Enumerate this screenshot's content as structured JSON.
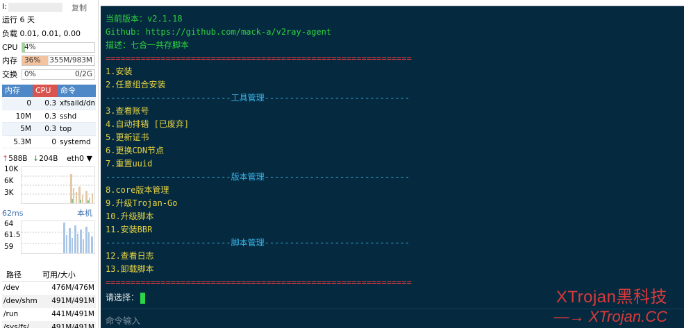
{
  "colors": {
    "terminal_bg": "#052a40",
    "green": "#2fd33b",
    "red": "#ff3b3b",
    "yellow": "#e6d23f",
    "blue": "#39b3e6",
    "watermark": "#d93a3a"
  },
  "monitor": {
    "ip_label": "I:",
    "copy_label": "复制",
    "uptime": "运行 6 天",
    "load": "负载 0.01, 0.01, 0.00",
    "cpu": {
      "label": "CPU",
      "value": "4%",
      "percent": 4
    },
    "memory": {
      "label": "内存",
      "value": "36%",
      "detail": "355M/983M",
      "percent": 36
    },
    "swap": {
      "label": "交换",
      "value": "0%",
      "detail": "0/2G",
      "percent": 0
    },
    "process_headers": [
      "内存",
      "CPU",
      "命令"
    ],
    "processes": [
      {
        "mem": "0",
        "cpu": "0.3",
        "cmd": "xfsaild/dn"
      },
      {
        "mem": "10M",
        "cpu": "0.3",
        "cmd": "sshd"
      },
      {
        "mem": "5M",
        "cpu": "0.3",
        "cmd": "top"
      },
      {
        "mem": "5.3M",
        "cpu": "0",
        "cmd": "systemd"
      }
    ],
    "net": {
      "up": "588B",
      "down": "204B",
      "iface": "eth0",
      "ticks": [
        "10K",
        "6K",
        "3K"
      ]
    },
    "ping": {
      "latency": "62ms",
      "host": "本机",
      "ticks": [
        "64",
        "61.5",
        "59"
      ]
    },
    "disk_headers": [
      "路径",
      "可用/大小"
    ],
    "disks": [
      {
        "path": "/dev",
        "size": "476M/476M"
      },
      {
        "path": "/dev/shm",
        "size": "491M/491M"
      },
      {
        "path": "/run",
        "size": "441M/491M"
      },
      {
        "path": "/sys/fs/",
        "size": "491M/491M"
      }
    ]
  },
  "terminal": {
    "version": "当前版本：v2.1.18",
    "github": "Github: https://github.com/mack-a/v2ray-agent",
    "desc": "描述：七合一共存脚本",
    "separator": "=============================================================",
    "items1": [
      "1.安装",
      "2.任意组合安装"
    ],
    "section_tools": "-------------------------工具管理-----------------------------",
    "items2": [
      "3.查看账号",
      "4.自动排错 [已废弃]",
      "5.更新证书",
      "6.更换CDN节点",
      "7.重置uuid"
    ],
    "section_version": "-------------------------版本管理-----------------------------",
    "items3": [
      "8.core版本管理",
      "9.升级Trojan-Go",
      "10.升级脚本",
      "11.安装BBR"
    ],
    "section_script": "-------------------------脚本管理-----------------------------",
    "items4": [
      "12.查看日志",
      "13.卸载脚本"
    ],
    "prompt": "请选择：",
    "command_placeholder": "命令输入"
  },
  "watermark": {
    "line1": "XTrojan黑科技",
    "line2": "—→ XTrojan.CC"
  }
}
